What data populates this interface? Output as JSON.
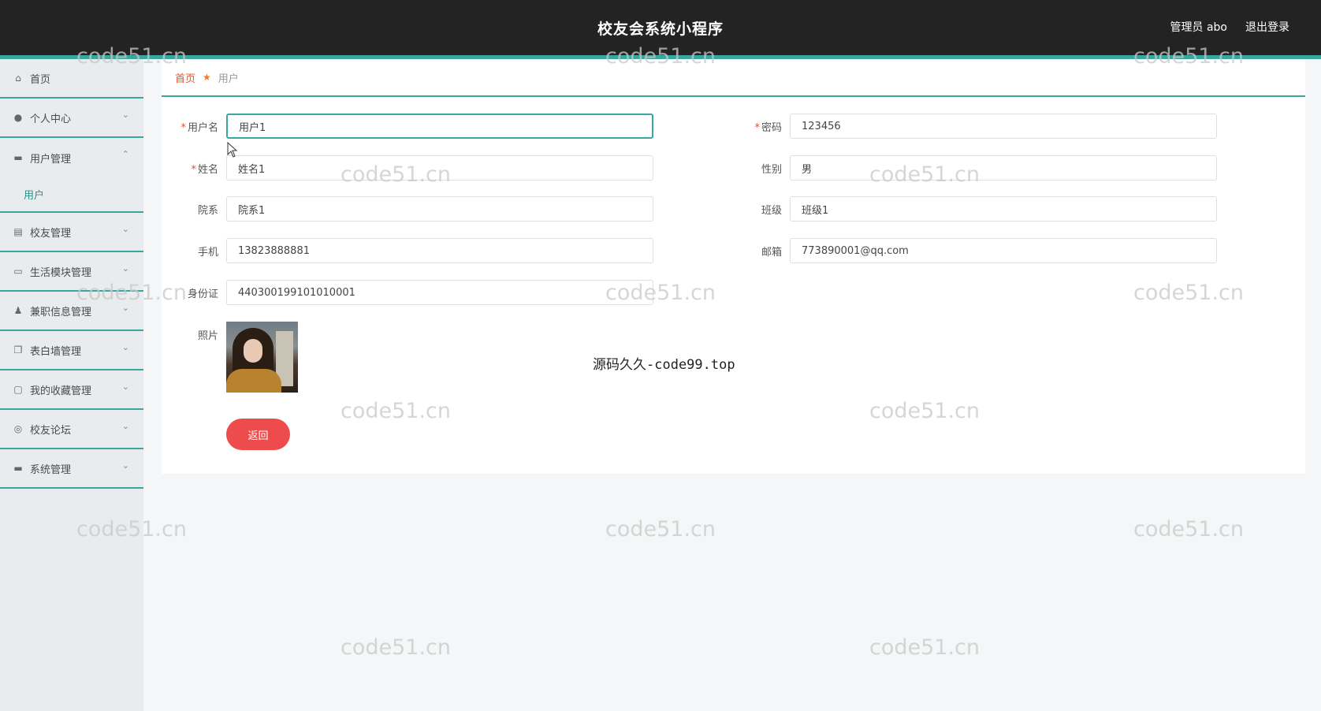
{
  "header": {
    "title": "校友会系统小程序",
    "user_role": "管理员 abo",
    "logout": "退出登录"
  },
  "sidebar": {
    "items": [
      {
        "label": "首页",
        "icon": "home-icon"
      },
      {
        "label": "个人中心",
        "icon": "user-icon"
      },
      {
        "label": "用户管理",
        "icon": "briefcase-icon"
      },
      {
        "label": "校友管理",
        "icon": "clipboard-icon"
      },
      {
        "label": "生活模块管理",
        "icon": "card-icon"
      },
      {
        "label": "兼职信息管理",
        "icon": "person-icon"
      },
      {
        "label": "表白墙管理",
        "icon": "copy-icon"
      },
      {
        "label": "我的收藏管理",
        "icon": "chat-icon"
      },
      {
        "label": "校友论坛",
        "icon": "globe-icon"
      },
      {
        "label": "系统管理",
        "icon": "ticket-icon"
      }
    ],
    "sub_item": "用户"
  },
  "breadcrumb": {
    "home": "首页",
    "current": "用户"
  },
  "form": {
    "username_label": "用户名",
    "username": "用户1",
    "password_label": "密码",
    "password": "123456",
    "name_label": "姓名",
    "name": "姓名1",
    "gender_label": "性别",
    "gender": "男",
    "department_label": "院系",
    "department": "院系1",
    "class_label": "班级",
    "class": "班级1",
    "phone_label": "手机",
    "phone": "13823888881",
    "email_label": "邮箱",
    "email": "773890001@qq.com",
    "idcard_label": "身份证",
    "idcard": "440300199101010001",
    "photo_label": "照片",
    "back_button": "返回"
  },
  "watermark": "code51.cn",
  "center_note": "源码久久-code99.top",
  "colors": {
    "accent": "#3aa79c",
    "header_bg": "#232323",
    "danger": "#ee4c4c"
  }
}
